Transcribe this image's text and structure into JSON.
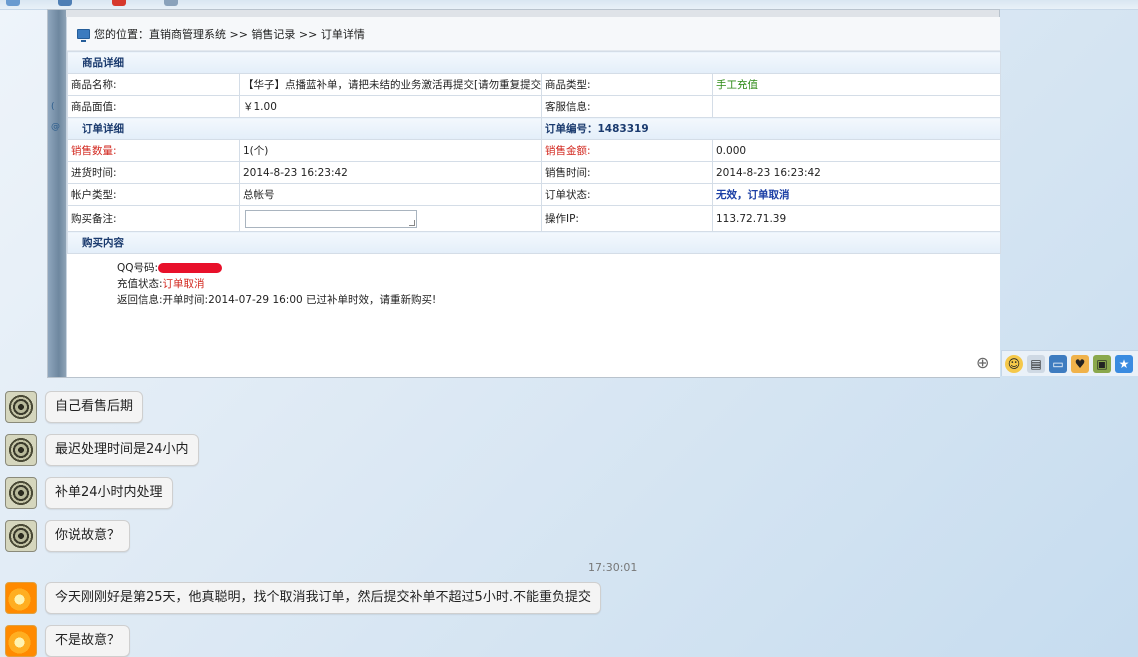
{
  "breadcrumb": {
    "label": "您的位置：",
    "path": "直销商管理系统 >> 销售记录 >> 订单详情"
  },
  "product_section": {
    "title": "商品详细",
    "rows": [
      {
        "l1": "商品名称:",
        "v1": "【华子】点播蓝补单，请把未结的业务激活再提交[请勿重复提交]",
        "l2": "商品类型:",
        "v2": "手工充值"
      },
      {
        "l1": "商品面值:",
        "v1": "￥1.00",
        "l2": "客服信息:",
        "v2": ""
      }
    ]
  },
  "order_section": {
    "title": "订单详细",
    "order_no_label": "订单编号：",
    "order_no": "1483319",
    "rows": [
      {
        "l1": "销售数量:",
        "v1": "1(个)",
        "l2": "销售金额:",
        "v2": "0.000"
      },
      {
        "l1": "进货时间:",
        "v1": "2014-8-23 16:23:42",
        "l2": "销售时间:",
        "v2": "2014-8-23 16:23:42"
      },
      {
        "l1": "帐户类型:",
        "v1": "总帐号",
        "l2": "订单状态:",
        "v2": "无效，订单取消"
      },
      {
        "l1": "购买备注:",
        "v1": "",
        "l2": "操作IP:",
        "v2": "113.72.71.39"
      }
    ]
  },
  "purchase_section": {
    "title": "购买内容",
    "qq_label": "QQ号码:",
    "status_label": "充值状态:",
    "status_value": "订单取消",
    "return_label": "返回信息:",
    "return_value": "开单时间:2014-07-29 16:00 已过补单时效，请重新购买!"
  },
  "chat": {
    "messages": [
      {
        "avatar": "swirl-avatar",
        "text": "自己看售后期"
      },
      {
        "avatar": "swirl-avatar",
        "text": "最迟处理时间是24小内"
      },
      {
        "avatar": "swirl-avatar",
        "text": "补单24小时内处理"
      },
      {
        "avatar": "swirl-avatar",
        "text": "你说故意？"
      }
    ],
    "timestamp": "17:30:01",
    "messages2": [
      {
        "avatar": "sun-avatar",
        "text": "今天刚刚好是第25天，他真聪明，找个取消我订单，然后提交补单不超过5小时.不能重负提交"
      },
      {
        "avatar": "sun-avatar",
        "text": "不是故意？"
      }
    ]
  },
  "colors": {
    "red": "#d2261d",
    "green": "#2c8a14",
    "blue": "#1b3fa5",
    "mask": "#e8102a"
  }
}
